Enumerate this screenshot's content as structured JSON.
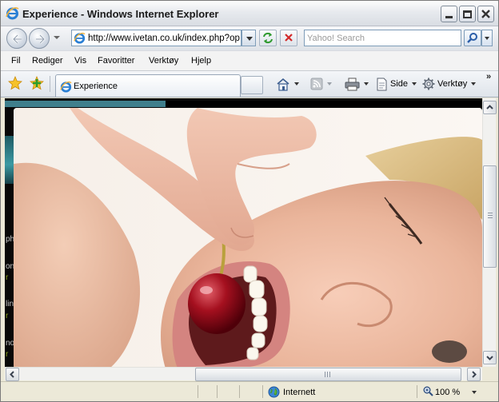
{
  "window": {
    "title": "Experience - Windows Internet Explorer"
  },
  "address_bar": {
    "url": "http://www.ivetan.co.uk/index.php?op",
    "search_placeholder": "Yahoo! Search"
  },
  "menu": {
    "items": [
      "Fil",
      "Rediger",
      "Vis",
      "Favoritter",
      "Verktøy",
      "Hjelp"
    ]
  },
  "toolbar": {
    "tab_title": "Experience",
    "page_label": "Side",
    "tools_label": "Verktøy",
    "more_chevron": "»"
  },
  "page": {
    "side_letters": [
      "ph",
      "on",
      "r",
      "lin",
      "r",
      "no",
      "r"
    ]
  },
  "status": {
    "zone": "Internett",
    "zoom": "100 %"
  },
  "colors": {
    "accent_teal": "#3f7f8c",
    "side_text_green": "#8aa21b"
  }
}
